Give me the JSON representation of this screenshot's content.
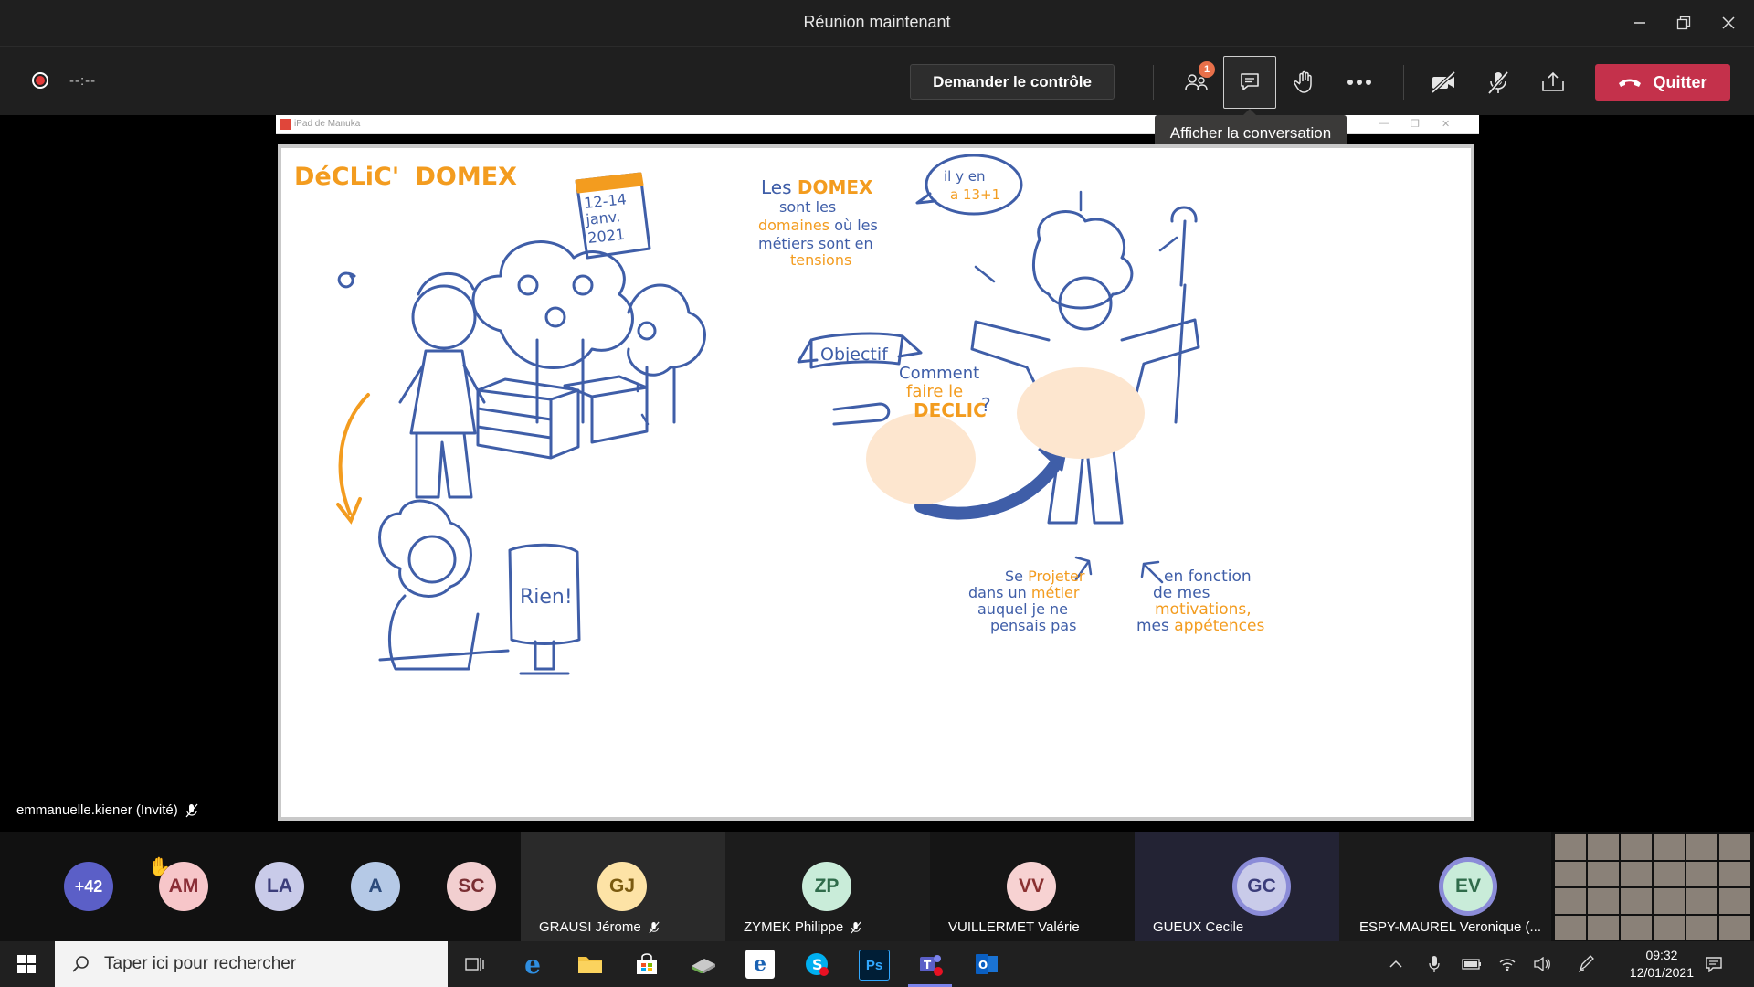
{
  "window": {
    "title": "Réunion maintenant"
  },
  "toolbar": {
    "timer": "--:--",
    "control_button": "Demander le contrôle",
    "participants_badge": "1",
    "leave_button": "Quitter",
    "tooltip": "Afficher la conversation"
  },
  "shared_screen": {
    "window_label": "iPad de Manuka",
    "drawing": {
      "title_part1": "DéCLiC'",
      "title_part2": "DOMEX",
      "calendar": [
        "12-14",
        "janv.",
        "2021"
      ],
      "bubble": [
        "il y en",
        "a 13+1"
      ],
      "definition": {
        "line1_a": "Les ",
        "line1_b": "DOMEX",
        "line2": "sont les",
        "line3_a": "domaines",
        "line3_b": " où les",
        "line4": "métiers sont en",
        "line5": "tensions"
      },
      "objectif": "Objectif",
      "comment": [
        "Comment",
        "faire le",
        "DECLIC",
        "?"
      ],
      "rien": "Rien!",
      "projeter": {
        "l1_a": "Se ",
        "l1_b": "Projeter",
        "l2_a": "dans un ",
        "l2_b": "métier",
        "l3": "auquel je ne",
        "l4": "pensais pas"
      },
      "fonction": {
        "l1": "en fonction",
        "l2": "de mes",
        "l3": "motivations,",
        "l4_a": "mes ",
        "l4_b": "appétences"
      }
    }
  },
  "presenter": {
    "name": "emmanuelle.kiener (Invité)"
  },
  "participants": {
    "overflow": "+42",
    "small": [
      {
        "initials": "AM",
        "color": "#f7c6c9",
        "text_color": "#8a2d36",
        "raised_hand": true
      },
      {
        "initials": "LA",
        "color": "#c9cbe9",
        "text_color": "#3b3d7a"
      },
      {
        "initials": "A",
        "color": "#b5c9e6",
        "text_color": "#2c4a7a"
      },
      {
        "initials": "SC",
        "color": "#f2cfd0",
        "text_color": "#7a2f33"
      }
    ],
    "tiles": [
      {
        "initials": "GJ",
        "name": "GRAUSI Jérome",
        "color": "#fde3a6",
        "text_color": "#7a5a10",
        "muted": true,
        "bg": "#2a2a2a"
      },
      {
        "initials": "ZP",
        "name": "ZYMEK Philippe",
        "color": "#c9ecd9",
        "text_color": "#2f6b4a",
        "muted": true,
        "bg": "#1c1c1c"
      },
      {
        "initials": "VV",
        "name": "VUILLERMET Valérie",
        "color": "#f7d2d2",
        "text_color": "#8a3030",
        "muted": false,
        "bg": "#151515"
      },
      {
        "initials": "GC",
        "name": "GUEUX Cecile",
        "color": "#c9cbe9",
        "text_color": "#3b3d7a",
        "muted": false,
        "bg": "#232334",
        "speaking": true
      },
      {
        "initials": "EV",
        "name": "ESPY-MAUREL Veronique (...",
        "color": "#c9ecd9",
        "text_color": "#2f6b4a",
        "muted": false,
        "bg": "#1b1b1b",
        "speaking": true
      }
    ]
  },
  "taskbar": {
    "search_placeholder": "Taper ici pour rechercher",
    "time": "09:32",
    "date": "12/01/2021",
    "apps": [
      "task-view",
      "edge",
      "file-explorer",
      "store",
      "books",
      "edge-enterprise",
      "skype",
      "photoshop",
      "teams",
      "outlook"
    ]
  },
  "colors": {
    "accent_orange": "#f39c1f",
    "drawing_blue": "#3f5ea8",
    "leave_red": "#c4314b"
  }
}
